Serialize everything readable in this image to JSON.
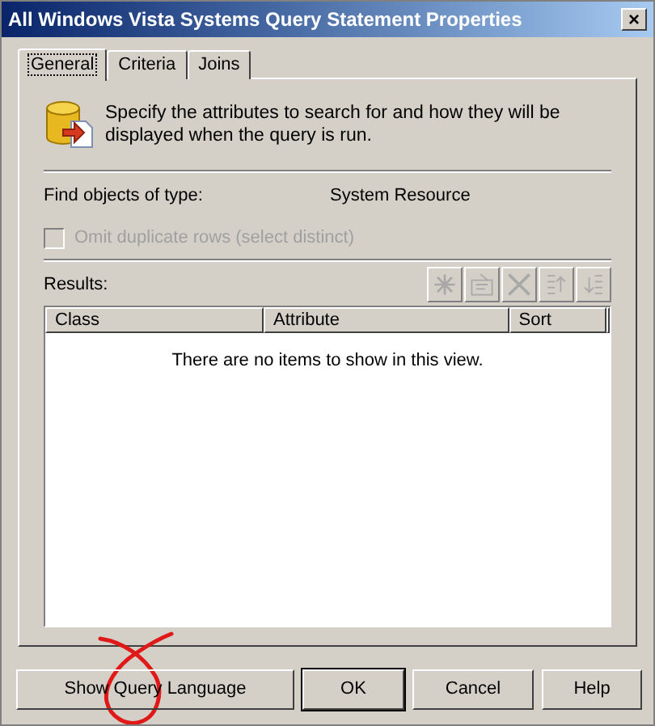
{
  "window": {
    "title": "All Windows Vista Systems Query Statement Properties",
    "close": "×"
  },
  "tabs": [
    {
      "label": "General",
      "selected": true
    },
    {
      "label": "Criteria",
      "selected": false
    },
    {
      "label": "Joins",
      "selected": false
    }
  ],
  "description": "Specify the attributes to search for and how they will be displayed when the query is run.",
  "object_type": {
    "label": "Find objects of type:",
    "value": "System Resource"
  },
  "omit_duplicates": {
    "label": "Omit duplicate rows (select distinct)",
    "checked": false,
    "disabled": true
  },
  "results": {
    "label": "Results:",
    "toolbar": [
      {
        "kind": "new",
        "disabled": true
      },
      {
        "kind": "properties",
        "disabled": true
      },
      {
        "kind": "delete",
        "disabled": true
      },
      {
        "kind": "up",
        "disabled": true
      },
      {
        "kind": "down",
        "disabled": true
      }
    ],
    "columns": [
      "Class",
      "Attribute",
      "Sort"
    ],
    "empty_text": "There are no items to show in this view."
  },
  "buttons": [
    {
      "label": "Show Query Language",
      "default": false
    },
    {
      "label": "OK",
      "default": true
    },
    {
      "label": "Cancel",
      "default": false
    },
    {
      "label": "Help",
      "default": false
    }
  ]
}
